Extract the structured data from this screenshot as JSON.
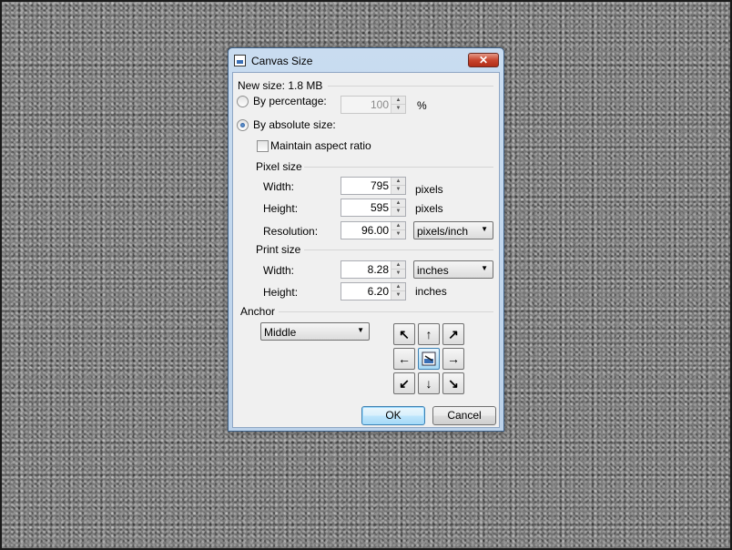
{
  "dialog": {
    "title": "Canvas Size",
    "close_glyph": "✕",
    "new_size": "New size: 1.8 MB",
    "by_percentage": {
      "label": "By percentage:",
      "value": "100",
      "unit": "%",
      "checked": false
    },
    "by_absolute": {
      "label": "By absolute size:",
      "checked": true
    },
    "maintain_aspect": {
      "label": "Maintain aspect ratio",
      "checked": false
    },
    "pixel_size": {
      "header": "Pixel size",
      "width_label": "Width:",
      "width_value": "795",
      "width_unit": "pixels",
      "height_label": "Height:",
      "height_value": "595",
      "height_unit": "pixels",
      "resolution_label": "Resolution:",
      "resolution_value": "96.00",
      "resolution_unit": "pixels/inch"
    },
    "print_size": {
      "header": "Print size",
      "width_label": "Width:",
      "width_value": "8.28",
      "width_unit": "inches",
      "height_label": "Height:",
      "height_value": "6.20",
      "height_unit": "inches"
    },
    "anchor": {
      "header": "Anchor",
      "selected": "Middle",
      "arrows": {
        "top_left": "↖",
        "top": "↑",
        "top_right": "↗",
        "left": "←",
        "right": "→",
        "bottom_left": "↙",
        "bottom": "↓",
        "bottom_right": "↘"
      }
    },
    "ok_label": "OK",
    "cancel_label": "Cancel"
  },
  "colors": {
    "titlebar": "#bcd2ea",
    "close_button": "#c8452e",
    "client_bg": "#f0f0f0",
    "canvas_bg": "#7c7c7c"
  }
}
